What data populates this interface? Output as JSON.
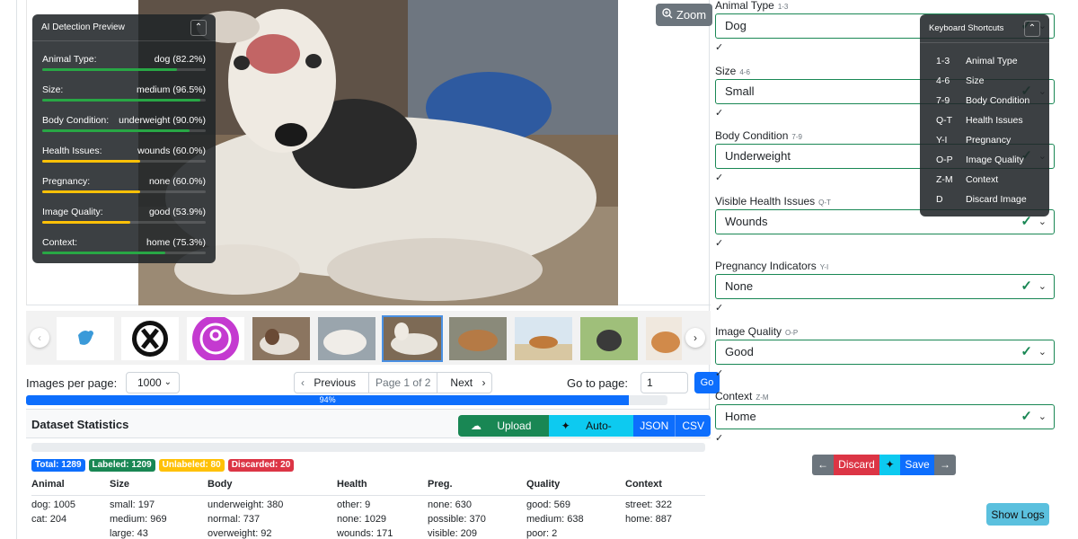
{
  "zoom_label": "Zoom",
  "ai_preview": {
    "title": "AI Detection Preview",
    "rows": [
      {
        "label": "Animal Type:",
        "value": "dog (82.2%)",
        "confidence": 0.822,
        "color": "#28a745"
      },
      {
        "label": "Size:",
        "value": "medium (96.5%)",
        "confidence": 0.965,
        "color": "#28a745"
      },
      {
        "label": "Body Condition:",
        "value": "underweight (90.0%)",
        "confidence": 0.9,
        "color": "#28a745"
      },
      {
        "label": "Health Issues:",
        "value": "wounds (60.0%)",
        "confidence": 0.6,
        "color": "#ffc107"
      },
      {
        "label": "Pregnancy:",
        "value": "none (60.0%)",
        "confidence": 0.6,
        "color": "#ffc107"
      },
      {
        "label": "Image Quality:",
        "value": "good (53.9%)",
        "confidence": 0.539,
        "color": "#ffc107"
      },
      {
        "label": "Context:",
        "value": "home (75.3%)",
        "confidence": 0.753,
        "color": "#28a745"
      }
    ]
  },
  "pagination": {
    "images_per_page_label": "Images per page:",
    "images_per_page_value": "1000",
    "previous": "Previous",
    "page_info": "Page 1 of 2",
    "next": "Next",
    "goto_label": "Go to page:",
    "goto_value": "1",
    "go_button": "Go"
  },
  "progress": {
    "label": "94%",
    "fraction": 0.94
  },
  "stats": {
    "title": "Dataset Statistics",
    "buttons": {
      "upload": "Upload Images",
      "autolabel": "Auto-Label All",
      "json": "JSON",
      "csv": "CSV"
    },
    "badges": [
      {
        "text": "Total: 1289",
        "color": "#0d6efd"
      },
      {
        "text": "Labeled: 1209",
        "color": "#198754"
      },
      {
        "text": "Unlabeled: 80",
        "color": "#ffc107"
      },
      {
        "text": "Discarded: 20",
        "color": "#dc3545"
      }
    ],
    "headers": [
      "Animal",
      "Size",
      "Body",
      "Health",
      "Preg.",
      "Quality",
      "Context"
    ],
    "columns": [
      [
        "dog: 1005",
        "cat: 204"
      ],
      [
        "small: 197",
        "medium: 969",
        "large: 43"
      ],
      [
        "underweight: 380",
        "normal: 737",
        "overweight: 92"
      ],
      [
        "other: 9",
        "none: 1029",
        "wounds: 171"
      ],
      [
        "none: 630",
        "possible: 370",
        "visible: 209"
      ],
      [
        "good: 569",
        "medium: 638",
        "poor: 2"
      ],
      [
        "street: 322",
        "home: 887"
      ]
    ]
  },
  "fields": [
    {
      "label": "Animal Type",
      "key": "1-3",
      "value": "Dog"
    },
    {
      "label": "Size",
      "key": "4-6",
      "value": "Small"
    },
    {
      "label": "Body Condition",
      "key": "7-9",
      "value": "Underweight"
    },
    {
      "label": "Visible Health Issues",
      "key": "Q-T",
      "value": "Wounds"
    },
    {
      "label": "Pregnancy Indicators",
      "key": "Y-I",
      "value": "None"
    },
    {
      "label": "Image Quality",
      "key": "O-P",
      "value": "Good"
    },
    {
      "label": "Context",
      "key": "Z-M",
      "value": "Home"
    }
  ],
  "check_glyph": "✓",
  "shortcuts": {
    "title": "Keyboard Shortcuts",
    "rows": [
      {
        "key": "1-3",
        "action": "Animal Type"
      },
      {
        "key": "4-6",
        "action": "Size"
      },
      {
        "key": "7-9",
        "action": "Body Condition"
      },
      {
        "key": "Q-T",
        "action": "Health Issues"
      },
      {
        "key": "Y-I",
        "action": "Pregnancy"
      },
      {
        "key": "O-P",
        "action": "Image Quality"
      },
      {
        "key": "Z-M",
        "action": "Context"
      },
      {
        "key": "D",
        "action": "Discard Image"
      }
    ]
  },
  "actions": {
    "discard": "Discard",
    "save": "Save"
  },
  "show_logs": "Show Logs"
}
